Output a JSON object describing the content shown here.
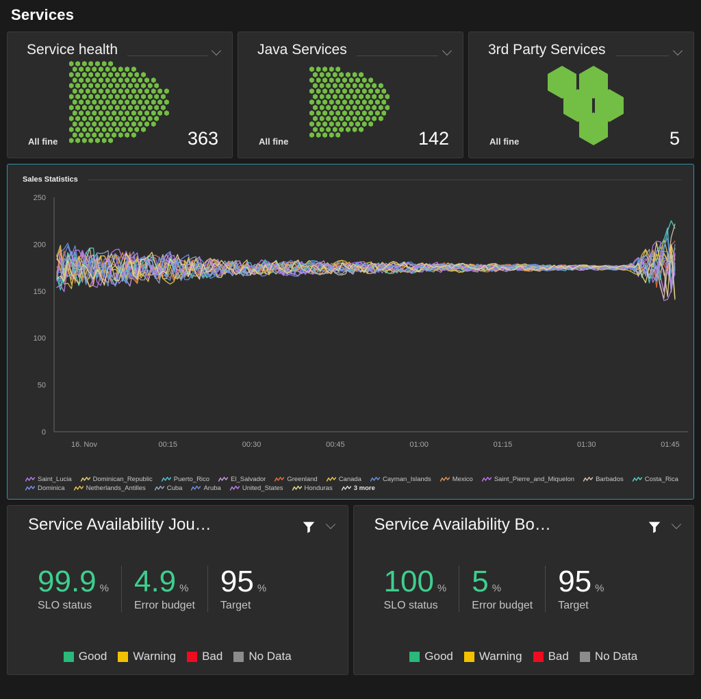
{
  "header": {
    "title": "Services"
  },
  "tiles": [
    {
      "title": "Service health",
      "status": "All fine",
      "count": "363",
      "viz": "honeycomb-dots",
      "color": "#73be44",
      "chevron_icon": "chevron-down-icon"
    },
    {
      "title": "Java Services",
      "status": "All fine",
      "count": "142",
      "viz": "honeycomb-dots",
      "color": "#73be44",
      "chevron_icon": "chevron-down-icon"
    },
    {
      "title": "3rd Party Services",
      "status": "All fine",
      "count": "5",
      "viz": "hexagon-cluster",
      "color": "#73be44",
      "chevron_icon": "chevron-down-icon"
    }
  ],
  "chart_panel": {
    "title": "Sales Statistics",
    "border_color": "#2e93a8",
    "more_label": "3 more",
    "more_glyph": "sparkline-icon"
  },
  "chart_data": {
    "type": "line",
    "title": "Sales Statistics",
    "xlabel": "",
    "ylabel": "",
    "ylim": [
      0,
      250
    ],
    "yticks": [
      0,
      50,
      100,
      150,
      200,
      250
    ],
    "xticks": [
      "16. Nov",
      "00:15",
      "00:30",
      "00:45",
      "01:00",
      "01:15",
      "01:30",
      "01:45"
    ],
    "grid": false,
    "legend_position": "bottom",
    "series": [
      {
        "name": "Saint_Lucia",
        "color": "#b07ee8"
      },
      {
        "name": "Dominican_Republic",
        "color": "#e8cf6b"
      },
      {
        "name": "Puerto_Rico",
        "color": "#4fc3d1"
      },
      {
        "name": "El_Salvador",
        "color": "#c39ae0"
      },
      {
        "name": "Greenland",
        "color": "#e8703a"
      },
      {
        "name": "Canada",
        "color": "#e8c44a"
      },
      {
        "name": "Cayman_Islands",
        "color": "#6b8fe0"
      },
      {
        "name": "Mexico",
        "color": "#e0914f"
      },
      {
        "name": "Saint_Pierre_and_Miquelon",
        "color": "#b875e8"
      },
      {
        "name": "Barbados",
        "color": "#d9c0a8"
      },
      {
        "name": "Costa_Rica",
        "color": "#4fd1c5"
      },
      {
        "name": "Dominica",
        "color": "#7b8fe8"
      },
      {
        "name": "Netherlands_Antilles",
        "color": "#e8c04a"
      },
      {
        "name": "Cuba",
        "color": "#8fa8c4"
      },
      {
        "name": "Aruba",
        "color": "#6b8fe0"
      },
      {
        "name": "United_States",
        "color": "#c07ee8"
      },
      {
        "name": "Honduras",
        "color": "#e8d98f"
      }
    ]
  },
  "slo_cards": [
    {
      "title": "Service Availability Jou…",
      "filter_icon": "funnel-icon",
      "chevron_icon": "chevron-down-icon",
      "metrics": [
        {
          "value": "99.9",
          "unit": "%",
          "label": "SLO status",
          "tone": "good"
        },
        {
          "value": "4.9",
          "unit": "%",
          "label": "Error budget",
          "tone": "good"
        },
        {
          "value": "95",
          "unit": "%",
          "label": "Target",
          "tone": "plain"
        }
      ]
    },
    {
      "title": "Service Availability Bo…",
      "filter_icon": "funnel-icon",
      "chevron_icon": "chevron-down-icon",
      "metrics": [
        {
          "value": "100",
          "unit": "%",
          "label": "SLO status",
          "tone": "good"
        },
        {
          "value": "5",
          "unit": "%",
          "label": "Error budget",
          "tone": "good"
        },
        {
          "value": "95",
          "unit": "%",
          "label": "Target",
          "tone": "plain"
        }
      ]
    }
  ],
  "slo_legend": [
    {
      "label": "Good",
      "color": "#2ab87b"
    },
    {
      "label": "Warning",
      "color": "#f2c200"
    },
    {
      "label": "Bad",
      "color": "#ef0b20"
    },
    {
      "label": "No Data",
      "color": "#8c8c8c"
    }
  ]
}
